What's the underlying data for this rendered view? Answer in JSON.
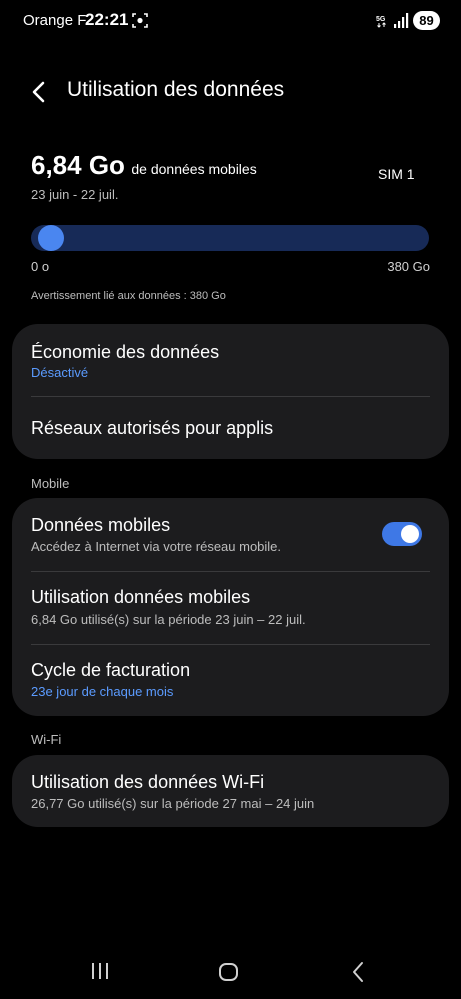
{
  "status_bar": {
    "carrier": "Orange F",
    "time": "22:21",
    "network": "5G",
    "battery": "89"
  },
  "header": {
    "title": "Utilisation des données"
  },
  "usage": {
    "amount": "6,84 Go",
    "description": "de données mobiles",
    "period": "23 juin - 22 juil.",
    "sim": "SIM 1",
    "progress_fraction": 0.018,
    "scale_min": "0 o",
    "scale_max": "380 Go",
    "warning": "Avertissement lié aux données : 380 Go"
  },
  "card_general": {
    "data_saver_title": "Économie des données",
    "data_saver_status": "Désactivé",
    "allowed_networks_title": "Réseaux autorisés pour applis"
  },
  "section_mobile": "Mobile",
  "card_mobile": {
    "mobile_data_title": "Données mobiles",
    "mobile_data_sub": "Accédez à Internet via votre réseau mobile.",
    "mobile_data_enabled": true,
    "mobile_usage_title": "Utilisation données mobiles",
    "mobile_usage_sub": "6,84 Go utilisé(s) sur la période 23 juin – 22 juil.",
    "billing_title": "Cycle de facturation",
    "billing_sub": "23e jour de chaque mois"
  },
  "section_wifi": "Wi-Fi",
  "card_wifi": {
    "wifi_usage_title": "Utilisation des données Wi-Fi",
    "wifi_usage_sub": "26,77 Go utilisé(s) sur la période 27 mai – 24 juin"
  },
  "colors": {
    "accent": "#4a86f0",
    "link": "#5b9bff",
    "track": "#172a57",
    "card": "#1c1c1e"
  }
}
